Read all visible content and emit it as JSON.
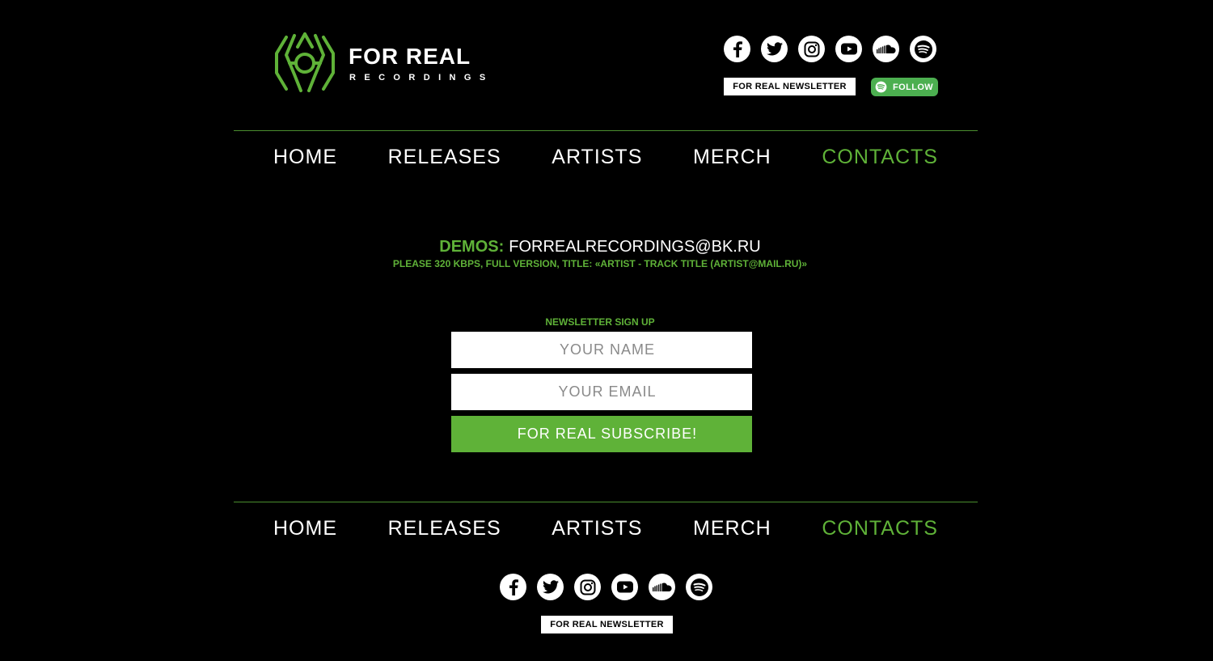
{
  "brand": {
    "title": "FOR REAL",
    "subtitle": "RECORDINGS",
    "accent_color": "#5fb238"
  },
  "social_icons": [
    "facebook-icon",
    "twitter-icon",
    "instagram-icon",
    "youtube-icon",
    "soundcloud-icon",
    "spotify-icon"
  ],
  "header": {
    "newsletter_label": "FOR REAL NEWSLETTER",
    "follow_label": "FOLLOW"
  },
  "nav": {
    "items": [
      "HOME",
      "RELEASES",
      "ARTISTS",
      "MERCH",
      "CONTACTS"
    ],
    "active": "CONTACTS"
  },
  "contacts": {
    "demos_label": "DEMOS:",
    "demos_email": "FORREALRECORDINGS@BK.RU",
    "demos_note": "PLEASE 320 KBPS, FULL VERSION, TITLE: «ARTIST - TRACK TITLE (ARTIST@MAIL.RU)»"
  },
  "signup": {
    "title": "NEWSLETTER SIGN UP",
    "name_placeholder": "YOUR NAME",
    "email_placeholder": "YOUR EMAIL",
    "submit_label": "FOR REAL SUBSCRIBE!"
  },
  "footer": {
    "newsletter_label": "FOR REAL NEWSLETTER"
  }
}
